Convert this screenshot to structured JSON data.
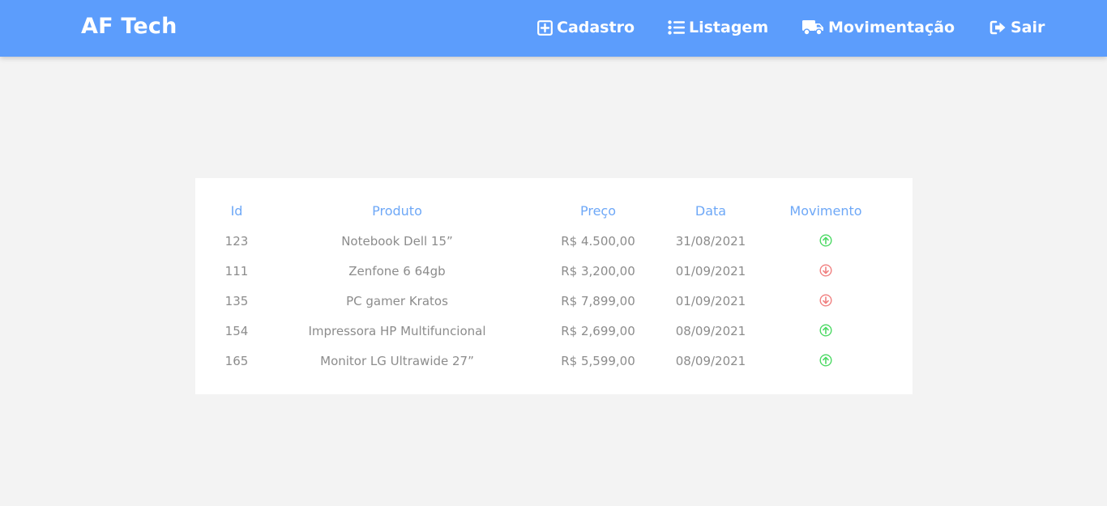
{
  "navbar": {
    "brand": "AF Tech",
    "items": [
      {
        "label": "Cadastro",
        "icon": "plus-square-icon"
      },
      {
        "label": "Listagem",
        "icon": "list-icon"
      },
      {
        "label": "Movimentação",
        "icon": "truck-icon"
      },
      {
        "label": "Sair",
        "icon": "sign-out-icon"
      }
    ],
    "color": "#5c9dfc"
  },
  "table": {
    "headers": {
      "id": "Id",
      "produto": "Produto",
      "preco": "Preço",
      "data": "Data",
      "movimento": "Movimento"
    },
    "rows": [
      {
        "id": "123",
        "produto": "Notebook Dell 15”",
        "preco": "R$ 4.500,00",
        "data": "31/08/2021",
        "movimento": "up"
      },
      {
        "id": "111",
        "produto": "Zenfone 6 64gb",
        "preco": "R$ 3,200,00",
        "data": "01/09/2021",
        "movimento": "down"
      },
      {
        "id": "135",
        "produto": "PC gamer Kratos",
        "preco": "R$ 7,899,00",
        "data": "01/09/2021",
        "movimento": "down"
      },
      {
        "id": "154",
        "produto": "Impressora HP Multifuncional",
        "preco": "R$ 2,699,00",
        "data": "08/09/2021",
        "movimento": "up"
      },
      {
        "id": "165",
        "produto": "Monitor LG Ultrawide 27”",
        "preco": "R$ 5,599,00",
        "data": "08/09/2021",
        "movimento": "up"
      }
    ]
  },
  "colors": {
    "header_text": "#6ea8f7",
    "movement_up": "#4cd964",
    "movement_down": "#f08080"
  },
  "icons": {
    "movement_up": "arrow-circle-up-icon",
    "movement_down": "arrow-circle-down-icon"
  }
}
